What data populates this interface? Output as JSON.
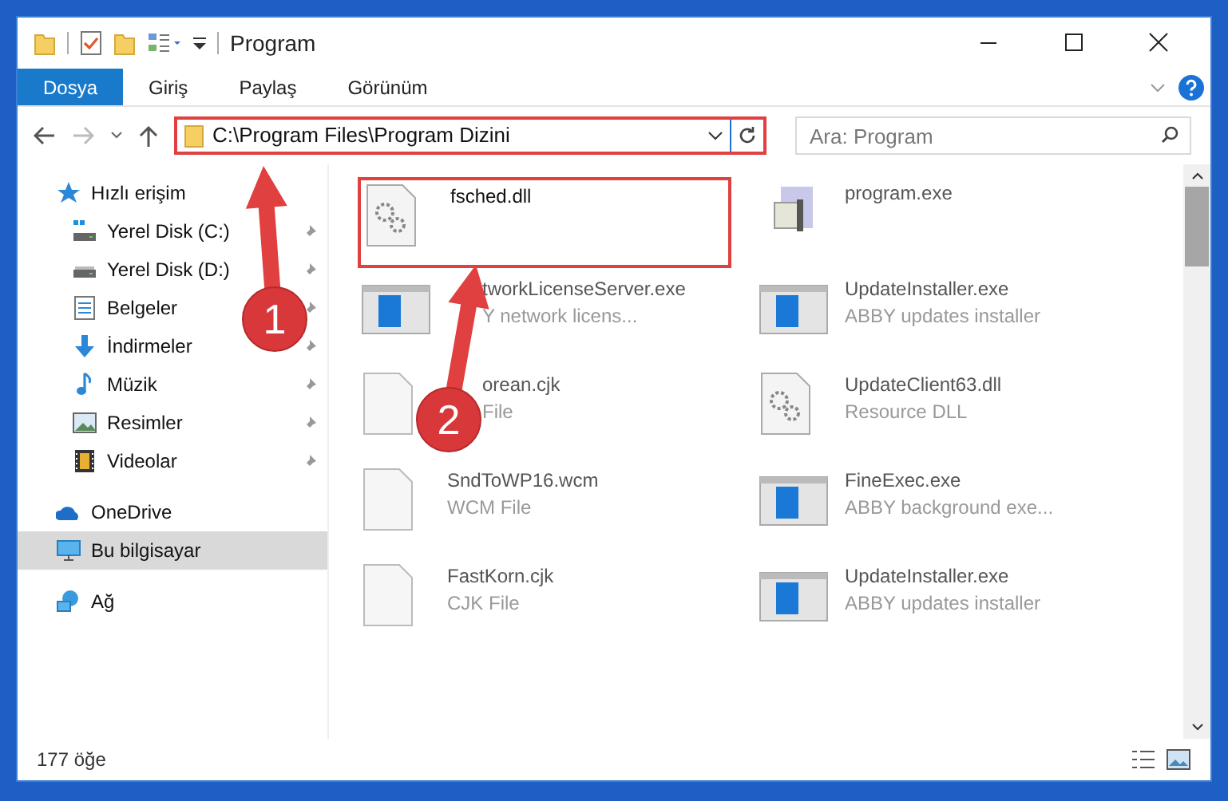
{
  "window": {
    "title": "Program"
  },
  "ribbon_tabs": [
    {
      "label": "Dosya",
      "selected": true
    },
    {
      "label": "Giriş",
      "selected": false
    },
    {
      "label": "Paylaş",
      "selected": false
    },
    {
      "label": "Görünüm",
      "selected": false
    }
  ],
  "address": {
    "path": "C:\\Program Files\\Program Dizini"
  },
  "search": {
    "placeholder": "Ara: Program"
  },
  "nav": [
    {
      "label": "Hızlı erişim",
      "kind": "star",
      "selected": false,
      "children": [
        {
          "label": "Yerel Disk (C:)",
          "kind": "drive_c",
          "pinned": true
        },
        {
          "label": "Yerel Disk (D:)",
          "kind": "drive",
          "pinned": true
        },
        {
          "label": "Belgeler",
          "kind": "docs",
          "pinned": true
        },
        {
          "label": "İndirmeler",
          "kind": "download",
          "pinned": true
        },
        {
          "label": "Müzik",
          "kind": "music",
          "pinned": true
        },
        {
          "label": "Resimler",
          "kind": "pictures",
          "pinned": true
        },
        {
          "label": "Videolar",
          "kind": "video",
          "pinned": true
        }
      ]
    },
    {
      "label": "OneDrive",
      "kind": "cloud",
      "selected": false
    },
    {
      "label": "Bu bilgisayar",
      "kind": "pc",
      "selected": true
    },
    {
      "label": "Ağ",
      "kind": "network",
      "selected": false
    }
  ],
  "files": [
    {
      "name": "fsched.dll",
      "kind": "dll",
      "highlighted": true,
      "covered": false
    },
    {
      "name": "program.exe",
      "kind": "app",
      "highlighted": false,
      "covered": false
    },
    {
      "name": "tworkLicenseServer.exe",
      "detail": "Y network licens...",
      "kind": "window",
      "highlighted": false,
      "covered": true
    },
    {
      "name": "UpdateInstaller.exe",
      "detail": "ABBY updates installer",
      "kind": "window",
      "highlighted": false,
      "covered": false
    },
    {
      "name": "orean.cjk",
      "detail": "File",
      "kind": "blank",
      "highlighted": false,
      "covered": true
    },
    {
      "name": "UpdateClient63.dll",
      "detail": "Resource DLL",
      "kind": "dll",
      "highlighted": false,
      "covered": false
    },
    {
      "name": "SndToWP16.wcm",
      "detail": "WCM File",
      "kind": "blank",
      "highlighted": false,
      "covered": false
    },
    {
      "name": "FineExec.exe",
      "detail": "ABBY background exe...",
      "kind": "window",
      "highlighted": false,
      "covered": false
    },
    {
      "name": "FastKorn.cjk",
      "detail": "CJK File",
      "kind": "blank",
      "highlighted": false,
      "covered": false
    },
    {
      "name": "UpdateInstaller.exe",
      "detail": "ABBY updates installer",
      "kind": "window",
      "highlighted": false,
      "covered": false
    }
  ],
  "annotations": [
    {
      "number": "1"
    },
    {
      "number": "2"
    }
  ],
  "status_bar": {
    "count": "177 öğe"
  }
}
